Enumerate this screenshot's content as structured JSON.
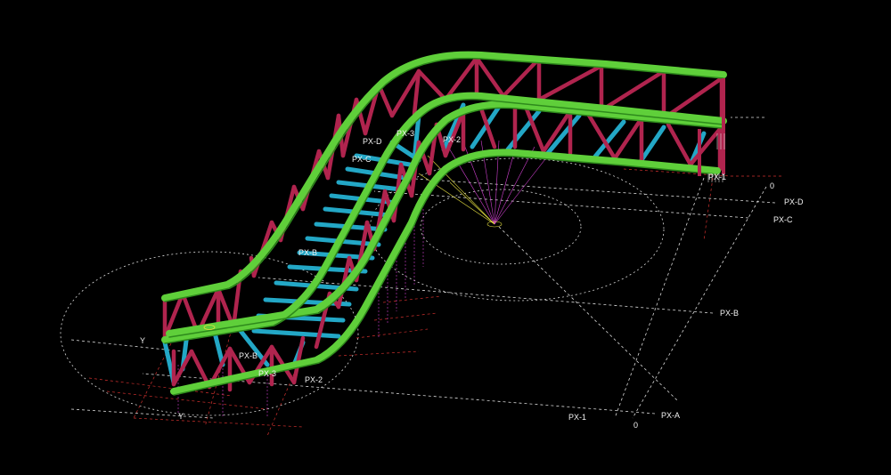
{
  "view": {
    "background": "#000000",
    "colors": {
      "chord": "#5fcf3a",
      "chord_edge": "#2e8a1c",
      "web": "#b0244e",
      "floor_beam": "#23a7c6",
      "grid_white": "#d9d9d9",
      "grid_red": "#d0302e",
      "grid_yellow": "#e6e040",
      "grid_magenta": "#d040d0"
    }
  },
  "grid_labels": {
    "px_d_right": "PX-D",
    "px_c_right": "PX-C",
    "px_b_right": "PX-B",
    "px_a_bottom": "PX-A",
    "px_1_bottom": "PX-1",
    "px_1_top_right": "PX-1",
    "px_d_upper": "PX-D",
    "px_c_upper": "PX-C",
    "px_3_upper": "PX-3",
    "px_2_upper": "PX-2",
    "px_b_mid": "PX-B",
    "px_b_lower": "PX-B",
    "px_3_lower": "PX-3",
    "px_2_lower": "PX-2",
    "zero_top": "0",
    "zero_bottom": "0",
    "y_upper": "Y",
    "y_lower": "Y"
  }
}
